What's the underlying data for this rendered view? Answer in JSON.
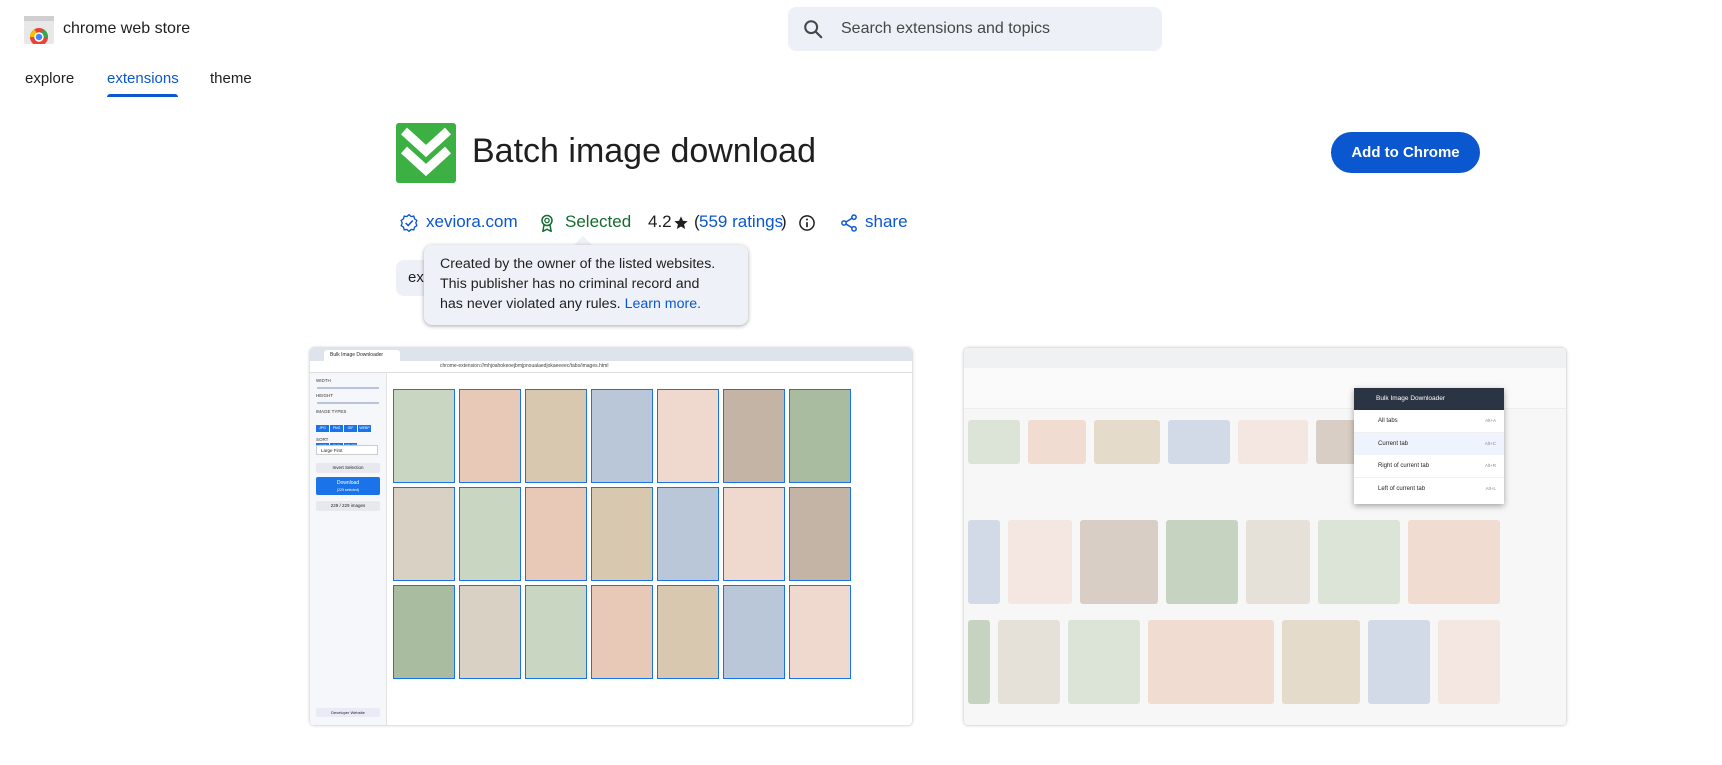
{
  "header": {
    "brand": "chrome web store",
    "search_placeholder": "Search extensions and topics",
    "nav": [
      {
        "label": "explore",
        "active": false
      },
      {
        "label": "extensions",
        "active": true
      },
      {
        "label": "theme",
        "active": false
      }
    ]
  },
  "item": {
    "title": "Batch image download",
    "add_button": "Add to Chrome",
    "publisher": "xeviora.com",
    "badge": "Selected",
    "rating": "4.2",
    "rating_open": "(",
    "ratings_count": "559 ratings",
    "rating_close": ")",
    "share": "share",
    "chip_label": "ext"
  },
  "tooltip": {
    "line1": "Created by the owner of the listed websites.",
    "line2": "This publisher has no criminal record and",
    "line3": "has never violated any rules.",
    "learn_more": "Learn more."
  },
  "screenshot1": {
    "tab_title": "Bulk Image Downloader",
    "url": "chrome-extension://mhjoahokeoejbmjpnoualaedjokaeeeec/tabs/images.html",
    "width_label": "WIDTH",
    "height_label": "HEIGHT",
    "image_types_label": "IMAGE TYPES",
    "types": [
      "JPG",
      "PNG",
      "GIF",
      "WEBP",
      "AVIF",
      "SVG",
      "OTHER"
    ],
    "sort_label": "SORT",
    "sort_value": "Large First",
    "invert_button": "Invert Selection",
    "download_button": "Download",
    "download_sub": "(229 selected)",
    "count": "229 / 229 images",
    "developer_link": "Developer Website"
  },
  "screenshot2": {
    "menu_title": "Bulk Image Downloader",
    "menu_items": [
      {
        "label": "All tabs",
        "shortcut": "Alt+A"
      },
      {
        "label": "Current tab",
        "shortcut": "Alt+C"
      },
      {
        "label": "Right of current tab",
        "shortcut": "Alt+R"
      },
      {
        "label": "Left of current tab",
        "shortcut": "Alt+L"
      }
    ]
  },
  "colors": {
    "accent": "#0b57d0",
    "green": "#146c2e",
    "icon_green": "#3cb043",
    "tooltip_bg": "#eef2f8",
    "search_bg": "#edf1f7"
  },
  "icons": [
    "chrome-web-store-logo-icon",
    "search-icon",
    "download-chevrons-icon",
    "verified-icon",
    "award-icon",
    "star-icon",
    "info-icon",
    "share-icon"
  ]
}
